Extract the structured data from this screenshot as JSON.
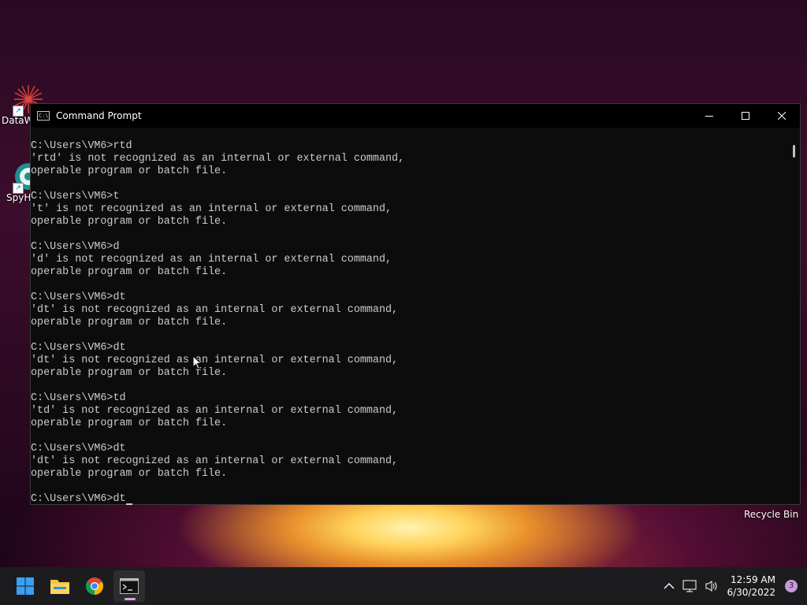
{
  "desktop": {
    "icons": [
      {
        "label": "DataW",
        "icon": "datawrapper-app-icon"
      },
      {
        "label": "SpyH",
        "icon": "spyhunter-app-icon"
      }
    ],
    "recycle_bin_label": "Recycle Bin"
  },
  "window": {
    "title": "Command Prompt",
    "icon": "cmd-icon",
    "controls": {
      "minimize": "minimize-icon",
      "maximize": "maximize-icon",
      "close": "close-icon"
    }
  },
  "console": {
    "lines": [
      "C:\\Users\\VM6>rtd",
      "'rtd' is not recognized as an internal or external command,",
      "operable program or batch file.",
      "",
      "C:\\Users\\VM6>t",
      "'t' is not recognized as an internal or external command,",
      "operable program or batch file.",
      "",
      "C:\\Users\\VM6>d",
      "'d' is not recognized as an internal or external command,",
      "operable program or batch file.",
      "",
      "C:\\Users\\VM6>dt",
      "'dt' is not recognized as an internal or external command,",
      "operable program or batch file.",
      "",
      "C:\\Users\\VM6>dt",
      "'dt' is not recognized as an internal or external command,",
      "operable program or batch file.",
      "",
      "C:\\Users\\VM6>td",
      "'td' is not recognized as an internal or external command,",
      "operable program or batch file.",
      "",
      "C:\\Users\\VM6>dt",
      "'dt' is not recognized as an internal or external command,",
      "operable program or batch file.",
      ""
    ],
    "prompt_input": "C:\\Users\\VM6>dt"
  },
  "taskbar": {
    "apps": [
      {
        "name": "start",
        "icon": "windows-start-icon"
      },
      {
        "name": "file-explorer",
        "icon": "folder-icon"
      },
      {
        "name": "chrome",
        "icon": "chrome-icon"
      },
      {
        "name": "command-prompt",
        "icon": "cmd-icon",
        "active": true
      }
    ],
    "time": "12:59 AM",
    "date": "6/30/2022",
    "notification_count": "3"
  },
  "colors": {
    "console_bg": "#0c0c0c",
    "console_text": "#cccccc",
    "taskbar_bg": "#1c1c1e",
    "accent": "#e0a2d8"
  }
}
